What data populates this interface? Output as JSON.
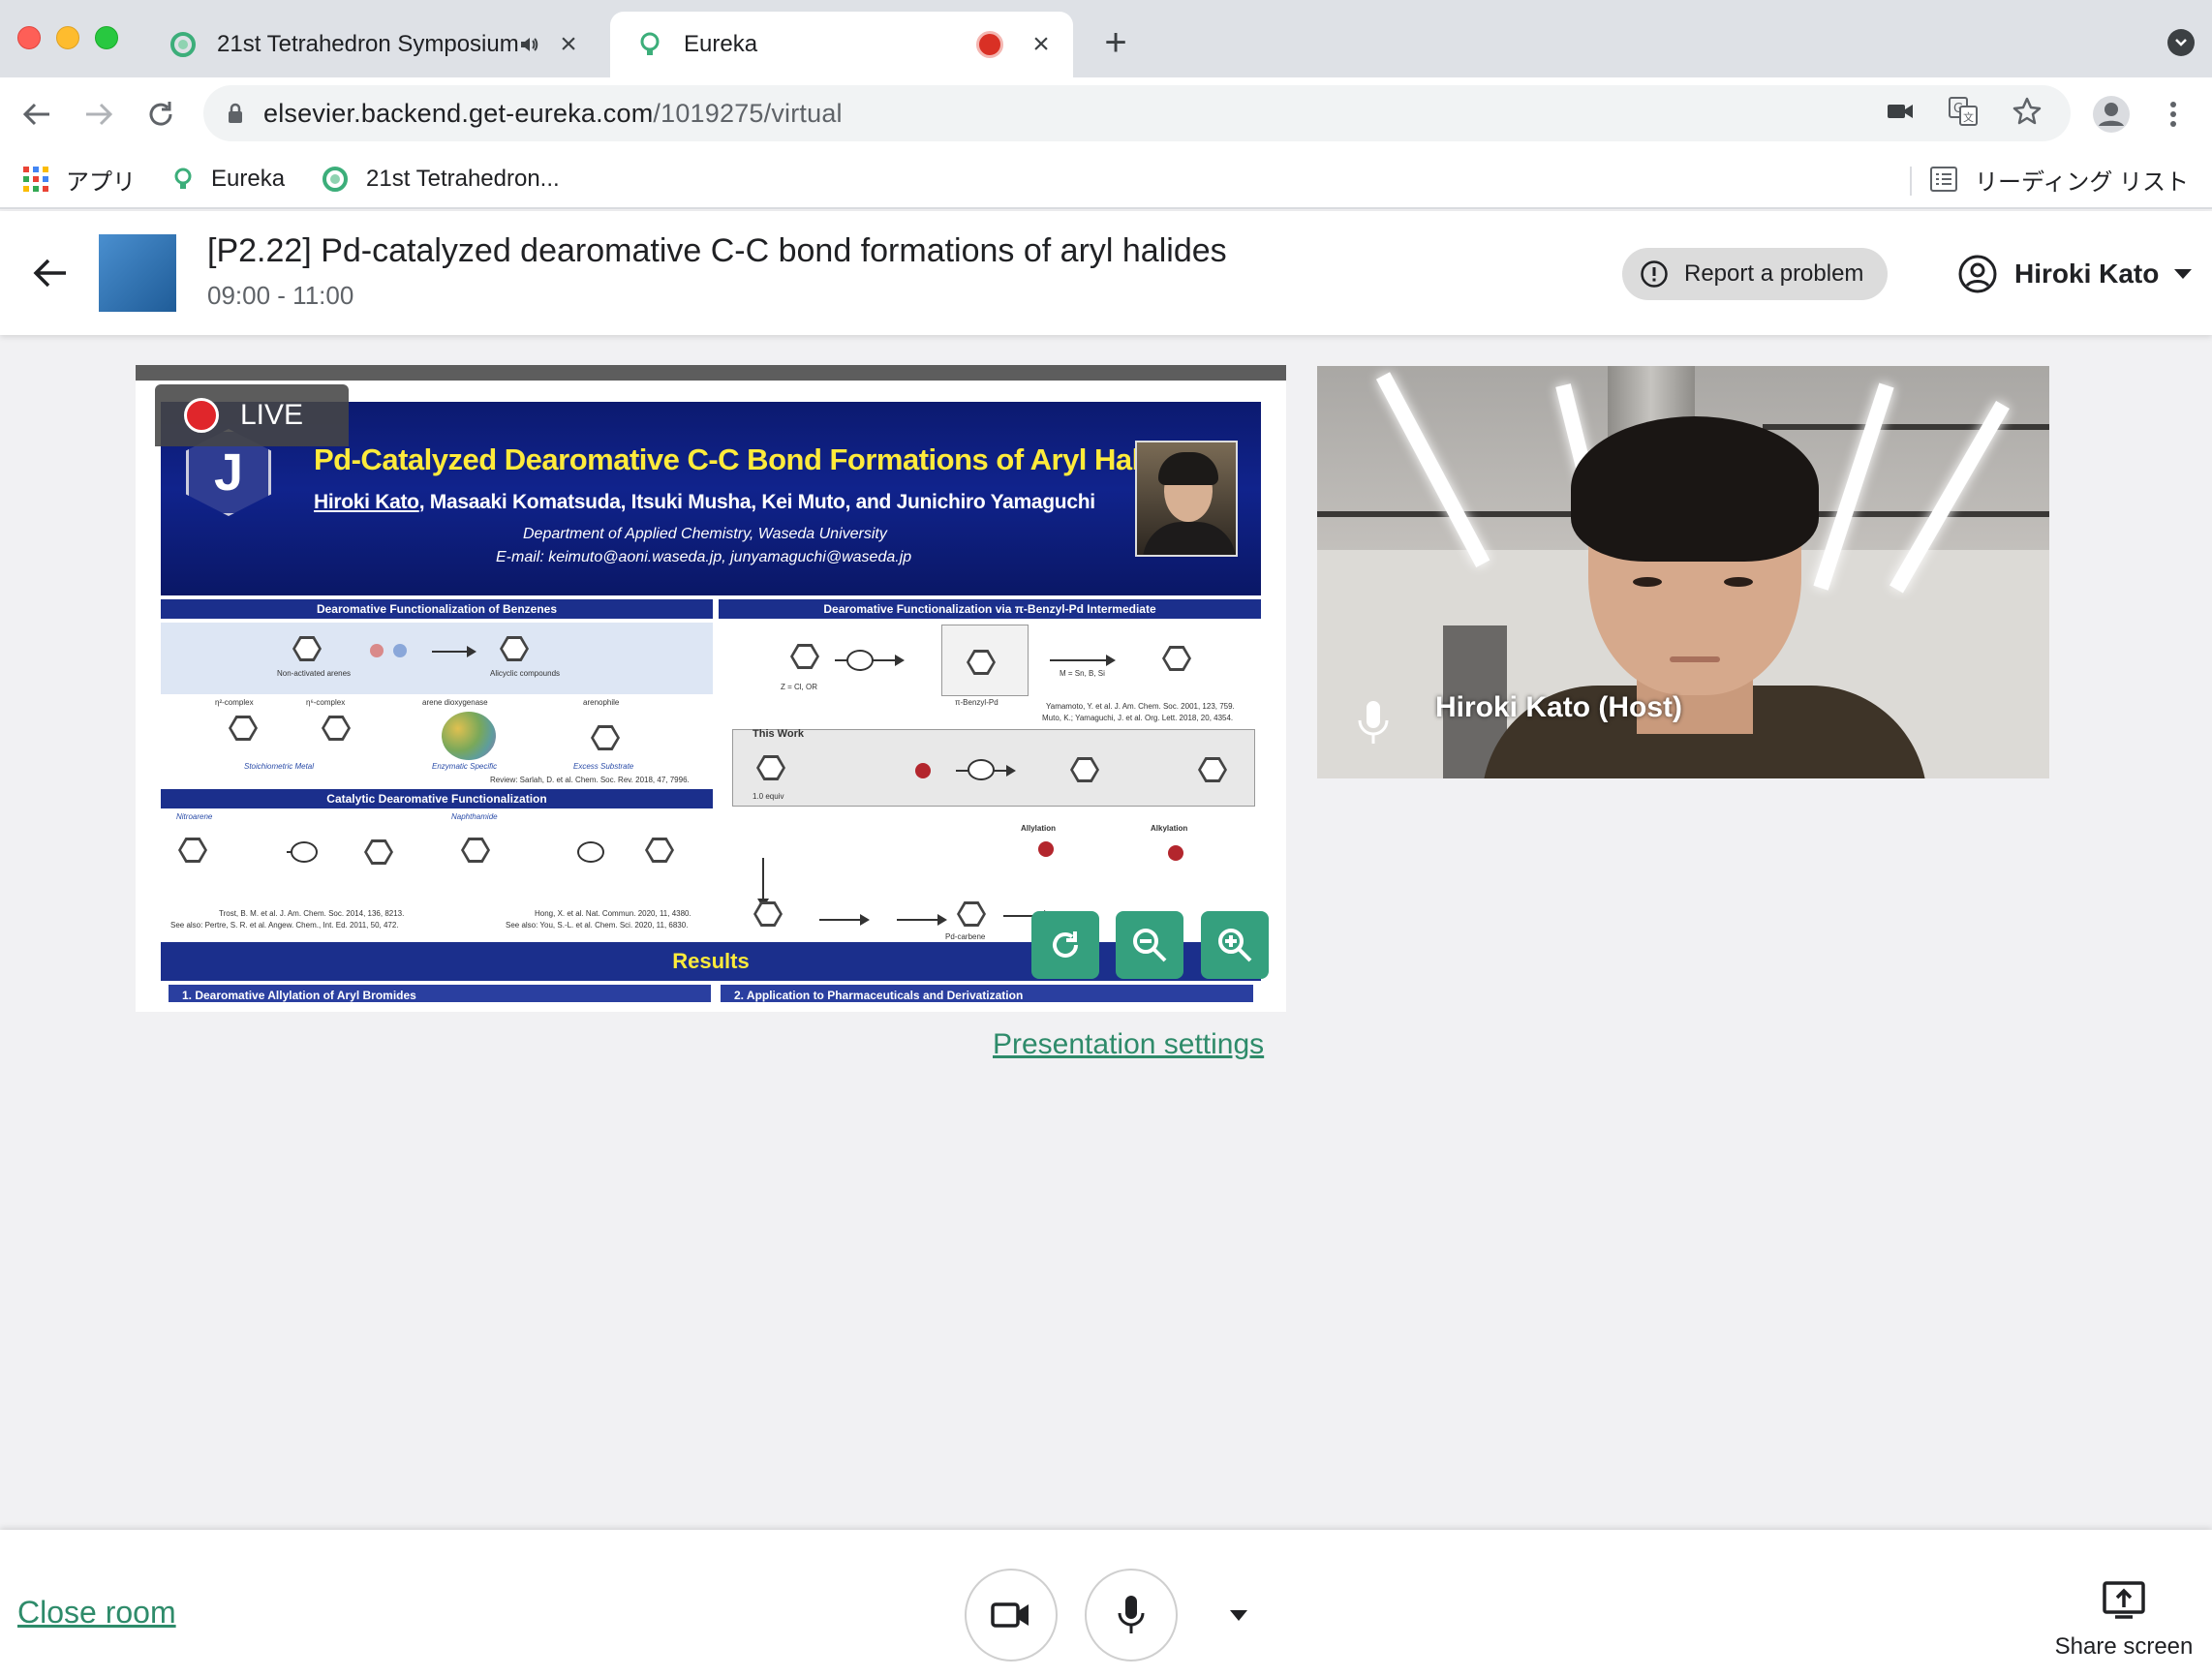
{
  "browser": {
    "tabs": [
      {
        "label": "21st Tetrahedron Symposium",
        "audio": true,
        "active": false
      },
      {
        "label": "Eureka",
        "recording": true,
        "active": true
      }
    ],
    "url_host": "elsevier.backend.get-eureka.com",
    "url_path": "/1019275/virtual",
    "bookmarks": [
      {
        "label": "アプリ",
        "icon": "apps-grid-icon"
      },
      {
        "label": "Eureka",
        "icon": "lightbulb-icon"
      },
      {
        "label": "21st Tetrahedron..."
      }
    ],
    "reading_list": "リーディング リスト"
  },
  "header": {
    "title": "[P2.22] Pd-catalyzed dearomative C-C bond formations of aryl halides",
    "time": "09:00 - 11:00",
    "report_label": "Report a problem",
    "user_name": "Hiroki Kato"
  },
  "presentation": {
    "live_label": "LIVE",
    "settings_label": "Presentation settings",
    "slide": {
      "logo_letter": "J",
      "title": "Pd-Catalyzed Dearomative C-C Bond Formations of Aryl Halides",
      "presenting_author": "Hiroki Kato",
      "authors_rest": ", Masaaki Komatsuda, Itsuki Musha, Kei Muto, and Junichiro Yamaguchi",
      "department": "Department of Applied Chemistry, Waseda University",
      "email": "E-mail: keimuto@aoni.waseda.jp, junyamaguchi@waseda.jp",
      "sec_left": "Dearomative Functionalization of Benzenes",
      "sec_right": "Dearomative Functionalization via π-Benzyl-Pd Intermediate",
      "sec_catalytic": "Catalytic Dearomative Functionalization",
      "this_work": "This Work",
      "results": "Results",
      "results_1": "1. Dearomative Allylation of Aryl Bromides",
      "results_2": "2. Application to Pharmaceuticals and Derivatization",
      "notes": {
        "non_activated": "Non-activated arenes",
        "alicyclic": "Alicyclic compounds",
        "eta2": "η²-complex",
        "eta6": "η⁶-complex",
        "arene_diox": "arene dioxygenase",
        "arenophile": "arenophile",
        "stoich": "Stoichiometric Metal",
        "enzymatic": "Enzymatic Specific",
        "excess": "Excess Substrate",
        "review": "Review: Sarlah, D. et al. Chem. Soc. Rev. 2018, 47, 7996.",
        "z_eq": "Z = Cl, OR",
        "benzyl_pd": "π-Benzyl-Pd",
        "m_eq": "M = Sn, B, Si",
        "yamamoto": "Yamamoto, Y. et al. J. Am. Chem. Soc. 2001, 123, 759.",
        "muto": "Muto, K.; Yamaguchi, J. et al. Org. Lett. 2018, 20, 4354.",
        "nitroarene": "Nitroarene",
        "naphthamide": "Naphthamide",
        "trost": "Trost, B. M. et al. J. Am. Chem. Soc. 2014, 136, 8213.",
        "see_also_1": "See also: Pertre, S. R. et al. Angew. Chem., Int. Ed. 2011, 50, 472.",
        "hong": "Hong, X. et al. Nat. Commun. 2020, 11, 4380.",
        "see_also_2": "See also: You, S.-L. et al. Chem. Sci. 2020, 11, 6830.",
        "equiv": "1.0 equiv",
        "allylation": "Allylation",
        "alkylation": "Alkylation",
        "pd_carbene": "Pd-carbene"
      }
    }
  },
  "video": {
    "participant_name": "Hiroki Kato (Host)"
  },
  "bottom": {
    "close_room": "Close room",
    "share_screen": "Share screen"
  },
  "colors": {
    "accent": "#35a07e",
    "link": "#2e8b6a",
    "live_red": "#e0262b",
    "slide_navy": "#10238c",
    "slide_title_yellow": "#ffeb3b"
  }
}
